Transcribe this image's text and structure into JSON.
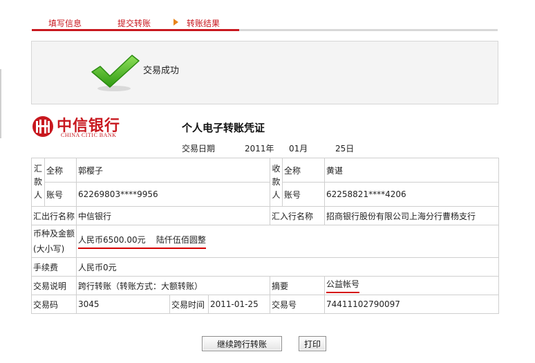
{
  "steps": [
    {
      "label": "填写信息"
    },
    {
      "label": "提交转账"
    },
    {
      "label": "转账结果"
    }
  ],
  "success": {
    "message": "交易成功",
    "icon": "check-icon"
  },
  "logo": {
    "cn": "中信银行",
    "en": "CHINA CITIC BANK",
    "color": "#c8181f"
  },
  "voucher": {
    "title": "个人电子转账凭证",
    "date_label": "交易日期",
    "year": "2011年",
    "month": "01月",
    "day": "25日",
    "payer_vertical": [
      "汇",
      "款",
      "人"
    ],
    "payee_vertical": [
      "收",
      "款",
      "人"
    ],
    "name_label": "全称",
    "account_label": "账号",
    "payer_name": "郭樱子",
    "payer_account": "62269803****9956",
    "payee_name": "黄谌",
    "payee_account": "62258821****4206",
    "payer_bank_label": "汇出行名称",
    "payer_bank": "中信银行",
    "payee_bank_label": "汇入行名称",
    "payee_bank": "招商银行股份有限公司上海分行曹杨支行",
    "currency_label_1": "币种及金额",
    "currency_label_2": "(大小写)",
    "amount": "人民币6500.00元",
    "amount_upper": "陆仟伍佰圆整",
    "fee_label": "手续费",
    "fee": "人民币0元",
    "desc_label": "交易说明",
    "desc": "跨行转账（转账方式：大额转账）",
    "memo_label": "摘要",
    "memo": "公益帐号",
    "code_label": "交易码",
    "code": "3045",
    "time_label": "交易时间",
    "time": "2011-01-25",
    "txn_no_label": "交易号",
    "txn_no": "74411102790097"
  },
  "buttons": {
    "continue": "继续跨行转账",
    "print": "打印"
  },
  "colors": {
    "accent": "#c8181f",
    "step_arrow": "#e8841a",
    "success_green": "#3fa91e",
    "highlight_underline": "#d40000"
  }
}
